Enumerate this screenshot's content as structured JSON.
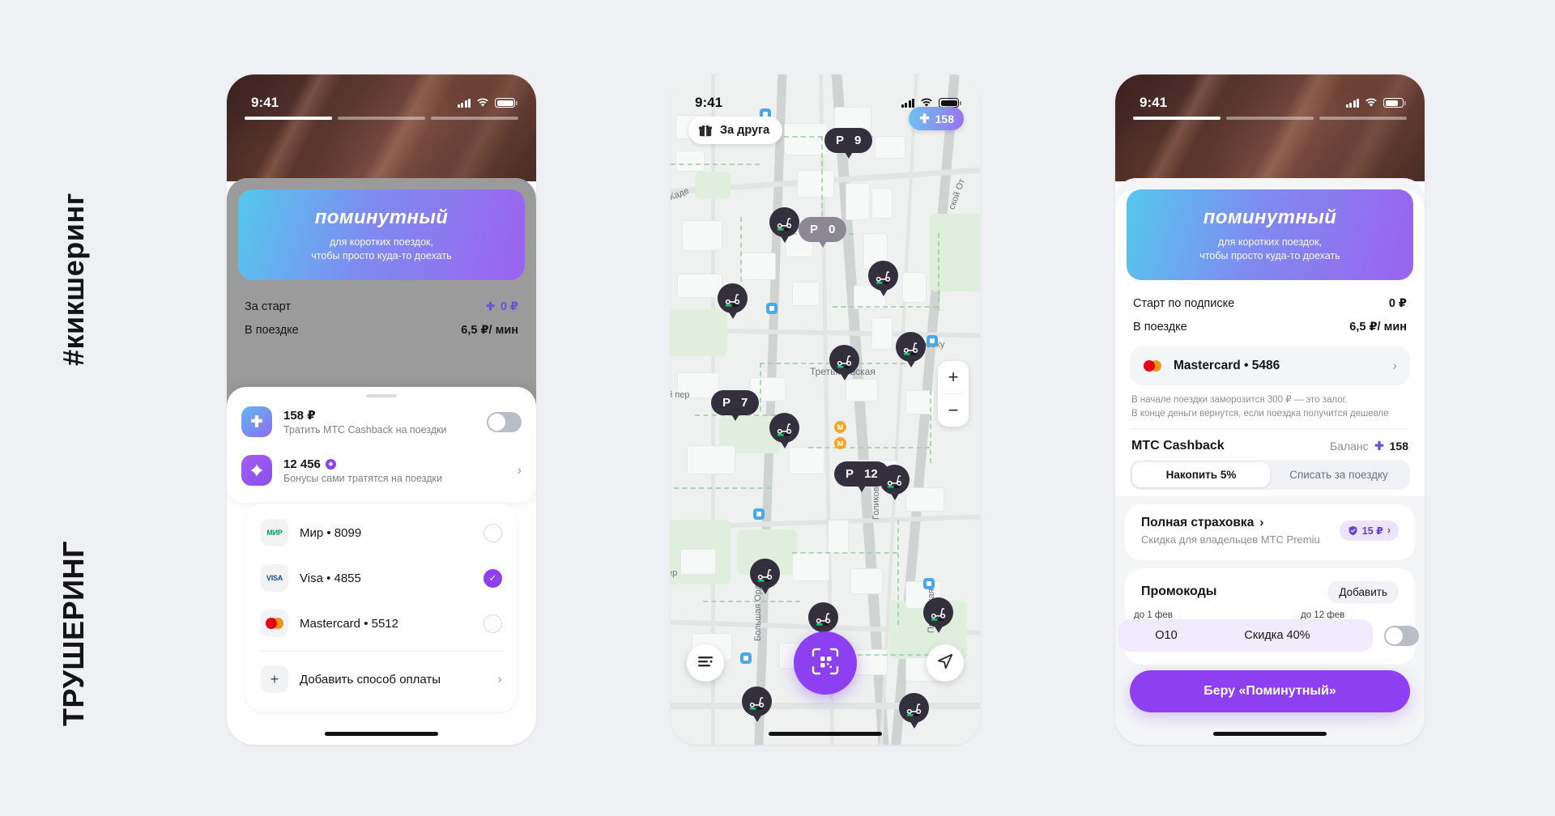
{
  "side_labels": {
    "top": "#кикшеринг",
    "bottom": "ТРУШЕРИНГ"
  },
  "colors": {
    "accent_purple": "#8d3ff2",
    "banner_gradient_from": "#55c8ee",
    "banner_gradient_to": "#9b62ee",
    "pin_dark": "#342f3d",
    "map_background": "#eef1ef"
  },
  "phone1": {
    "status": {
      "time": "9:41",
      "signal_icon": "signal-icon",
      "wifi_icon": "wifi-icon",
      "battery_icon": "battery-icon"
    },
    "story_progress": {
      "total": 3,
      "active_index": 0
    },
    "banner": {
      "title": "поминутный",
      "subtitle_line1": "для коротких  поездок,",
      "subtitle_line2": "чтобы просто куда-то доехать"
    },
    "prices": [
      {
        "label": "За старт",
        "value": "0 ₽",
        "has_cashback_icon": true
      },
      {
        "label": "В поездке",
        "value": "6,5 ₽/ мин",
        "has_cashback_icon": false
      }
    ],
    "cashback_card": {
      "rows": [
        {
          "icon": "cashback-icon",
          "title": "158 ₽",
          "subtitle": "Тратить МТС Cashback на поездки",
          "control": "toggle",
          "toggle_on": false
        },
        {
          "icon": "bonus-diamond-icon",
          "title": "12 456",
          "title_badge": "bonus-diamond-badge",
          "subtitle": "Бонусы сами тратятся на поездки",
          "control": "chevron",
          "chevron": "›"
        }
      ]
    },
    "payments": {
      "methods": [
        {
          "brand": "МИР",
          "brand_icon": "mir-icon",
          "label": "Мир • 8099",
          "selected": false
        },
        {
          "brand": "VISA",
          "brand_icon": "visa-icon",
          "label": "Visa • 4855",
          "selected": true
        },
        {
          "brand": "MC",
          "brand_icon": "mastercard-icon",
          "label": "Mastercard • 5512",
          "selected": false
        }
      ],
      "add_label": "Добавить способ оплаты",
      "add_icon": "plus-icon",
      "add_chevron": "›"
    }
  },
  "phone2": {
    "status": {
      "time": "9:41",
      "signal_icon": "signal-icon",
      "wifi_icon": "wifi-icon",
      "battery_icon": "battery-icon"
    },
    "friend_chip": {
      "label": "За друга",
      "icon": "gift-icon"
    },
    "cashback_chip": {
      "value": "158",
      "icon": "cashback-icon"
    },
    "parking_pins": [
      {
        "letter": "P",
        "count": "9",
        "muted": false
      },
      {
        "letter": "P",
        "count": "0",
        "muted": true
      },
      {
        "letter": "P",
        "count": "7",
        "muted": false
      },
      {
        "letter": "P",
        "count": "12",
        "muted": false
      }
    ],
    "scooter_pin_count": 12,
    "street_labels": [
      "Каде",
      "ской От",
      "Новоку",
      "Третьяковская",
      "ий пер",
      "Голиковск",
      "Большая Ордынка",
      "Пятницкая",
      "пер"
    ],
    "zoom_controls": {
      "zoom_in": "+",
      "zoom_out": "−"
    },
    "bottom_controls": {
      "filter_icon": "filters-icon",
      "scan_icon": "qr-scan-icon",
      "locate_icon": "locate-arrow-icon"
    }
  },
  "phone3": {
    "status": {
      "time": "9:41",
      "signal_icon": "signal-icon",
      "wifi_icon": "wifi-icon",
      "battery_icon": "battery-icon"
    },
    "story_progress": {
      "total": 3,
      "active_index": 0
    },
    "banner": {
      "title": "поминутный",
      "subtitle_line1": "для коротких  поездок,",
      "subtitle_line2": "чтобы просто куда-то доехать"
    },
    "prices": [
      {
        "label": "Старт по подписке",
        "value": "0 ₽"
      },
      {
        "label": "В поездке",
        "value": "6,5 ₽/ мин"
      }
    ],
    "payment": {
      "icon": "mastercard-icon",
      "label": "Mastercard • 5486",
      "chevron": "›"
    },
    "deposit_note_line1": "В начале поездки заморозится 300 ₽ — это залог.",
    "deposit_note_line2": "В конце деньги вернутся, если поездка получится дешевле",
    "cashback": {
      "title": "МТС Cashback",
      "balance_label": "Баланс",
      "balance_value": "158",
      "balance_icon": "cashback-icon",
      "segments": [
        {
          "label": "Накопить 5%",
          "active": true
        },
        {
          "label": "Списать за поездку",
          "active": false
        }
      ]
    },
    "insurance": {
      "title": "Полная страховка",
      "title_chevron": "›",
      "subtitle": "Скидка для владельцев МТС Premiu",
      "badge_value": "15 ₽",
      "badge_icon": "shield-icon",
      "badge_chevron": "›"
    },
    "promo": {
      "title": "Промокоды",
      "add_label": "Добавить",
      "items": [
        {
          "tag": "до 1 фев",
          "label": "О10"
        },
        {
          "tag": "до 12 фев",
          "label": "Скидка 40%"
        }
      ]
    },
    "cta_label": "Беру «Поминутный»"
  }
}
